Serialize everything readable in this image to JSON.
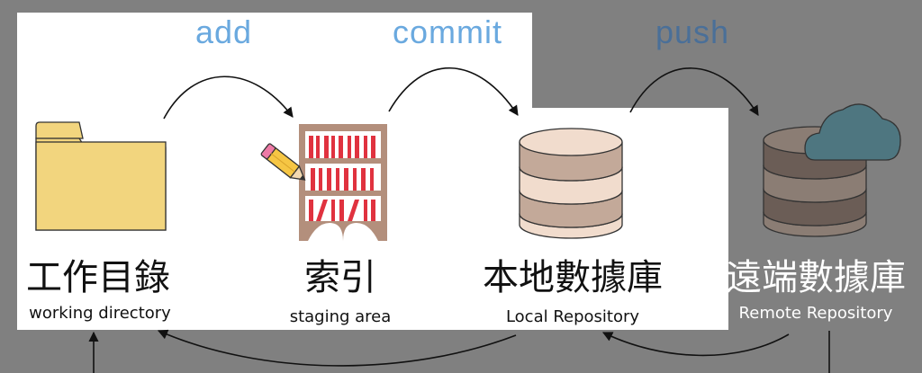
{
  "steps": [
    {
      "verb": "add"
    },
    {
      "verb": "commit"
    },
    {
      "verb": "push"
    }
  ],
  "nodes": [
    {
      "label_zh": "工作目錄",
      "label_en": "working directory",
      "icon": "folder-icon"
    },
    {
      "label_zh": "索引",
      "label_en": "staging area",
      "icon": "bookshelf-icon"
    },
    {
      "label_zh": "本地數據庫",
      "label_en": "Local Repository",
      "icon": "database-icon"
    },
    {
      "label_zh": "遠端數據庫",
      "label_en": "Remote Repository",
      "icon": "cloud-database-icon"
    }
  ],
  "colors": {
    "background": "#808080",
    "panel": "#ffffff",
    "verb_light": "#6aa9df",
    "verb_dark": "#4a6f98",
    "folder": "#f2d57e",
    "shelf": "#b38f7c",
    "books": "#e0323f",
    "db_local": "#f1dccd",
    "db_remote": "#6b5d56",
    "cloud": "#4e7680"
  }
}
